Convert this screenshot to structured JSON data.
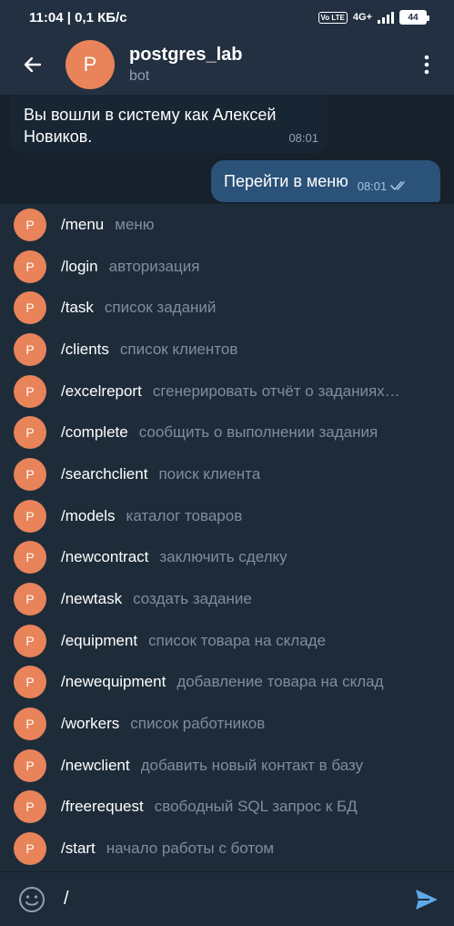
{
  "status_bar": {
    "time": "11:04",
    "separator": "|",
    "speed": "0,1 КБ/с",
    "volte": "Vo LTE",
    "network": "4G+",
    "battery": "44"
  },
  "header": {
    "avatar_letter": "P",
    "title": "postgres_lab",
    "subtitle": "bot"
  },
  "messages": {
    "incoming": {
      "text": "Вы вошли в систему как Алексей Новиков.",
      "time": "08:01"
    },
    "outgoing": {
      "text": "Перейти в меню",
      "time": "08:01"
    }
  },
  "commands": [
    {
      "avatar": "P",
      "name": "/menu",
      "desc": "меню"
    },
    {
      "avatar": "P",
      "name": "/login",
      "desc": "авторизация"
    },
    {
      "avatar": "P",
      "name": "/task",
      "desc": "список заданий"
    },
    {
      "avatar": "P",
      "name": "/clients",
      "desc": "список клиентов"
    },
    {
      "avatar": "P",
      "name": "/excelreport",
      "desc": "сгенерировать отчёт о заданиях…"
    },
    {
      "avatar": "P",
      "name": "/complete",
      "desc": "сообщить о выполнении задания"
    },
    {
      "avatar": "P",
      "name": "/searchclient",
      "desc": "поиск клиента"
    },
    {
      "avatar": "P",
      "name": "/models",
      "desc": "каталог товаров"
    },
    {
      "avatar": "P",
      "name": "/newcontract",
      "desc": "заключить сделку"
    },
    {
      "avatar": "P",
      "name": "/newtask",
      "desc": "создать задание"
    },
    {
      "avatar": "P",
      "name": "/equipment",
      "desc": "список товара на складе"
    },
    {
      "avatar": "P",
      "name": "/newequipment",
      "desc": "добавление товара на склад"
    },
    {
      "avatar": "P",
      "name": "/workers",
      "desc": "список работников"
    },
    {
      "avatar": "P",
      "name": "/newclient",
      "desc": "добавить новый контакт в базу"
    },
    {
      "avatar": "P",
      "name": "/freerequest",
      "desc": "свободный SQL запрос к БД"
    },
    {
      "avatar": "P",
      "name": "/start",
      "desc": "начало работы с ботом"
    }
  ],
  "input": {
    "value": "/"
  },
  "colors": {
    "avatar": "#e8835a",
    "header_bg": "#223041",
    "list_bg": "#1e2c3a",
    "outgoing_bubble": "#2b5278",
    "send_icon": "#5ea9ea"
  }
}
